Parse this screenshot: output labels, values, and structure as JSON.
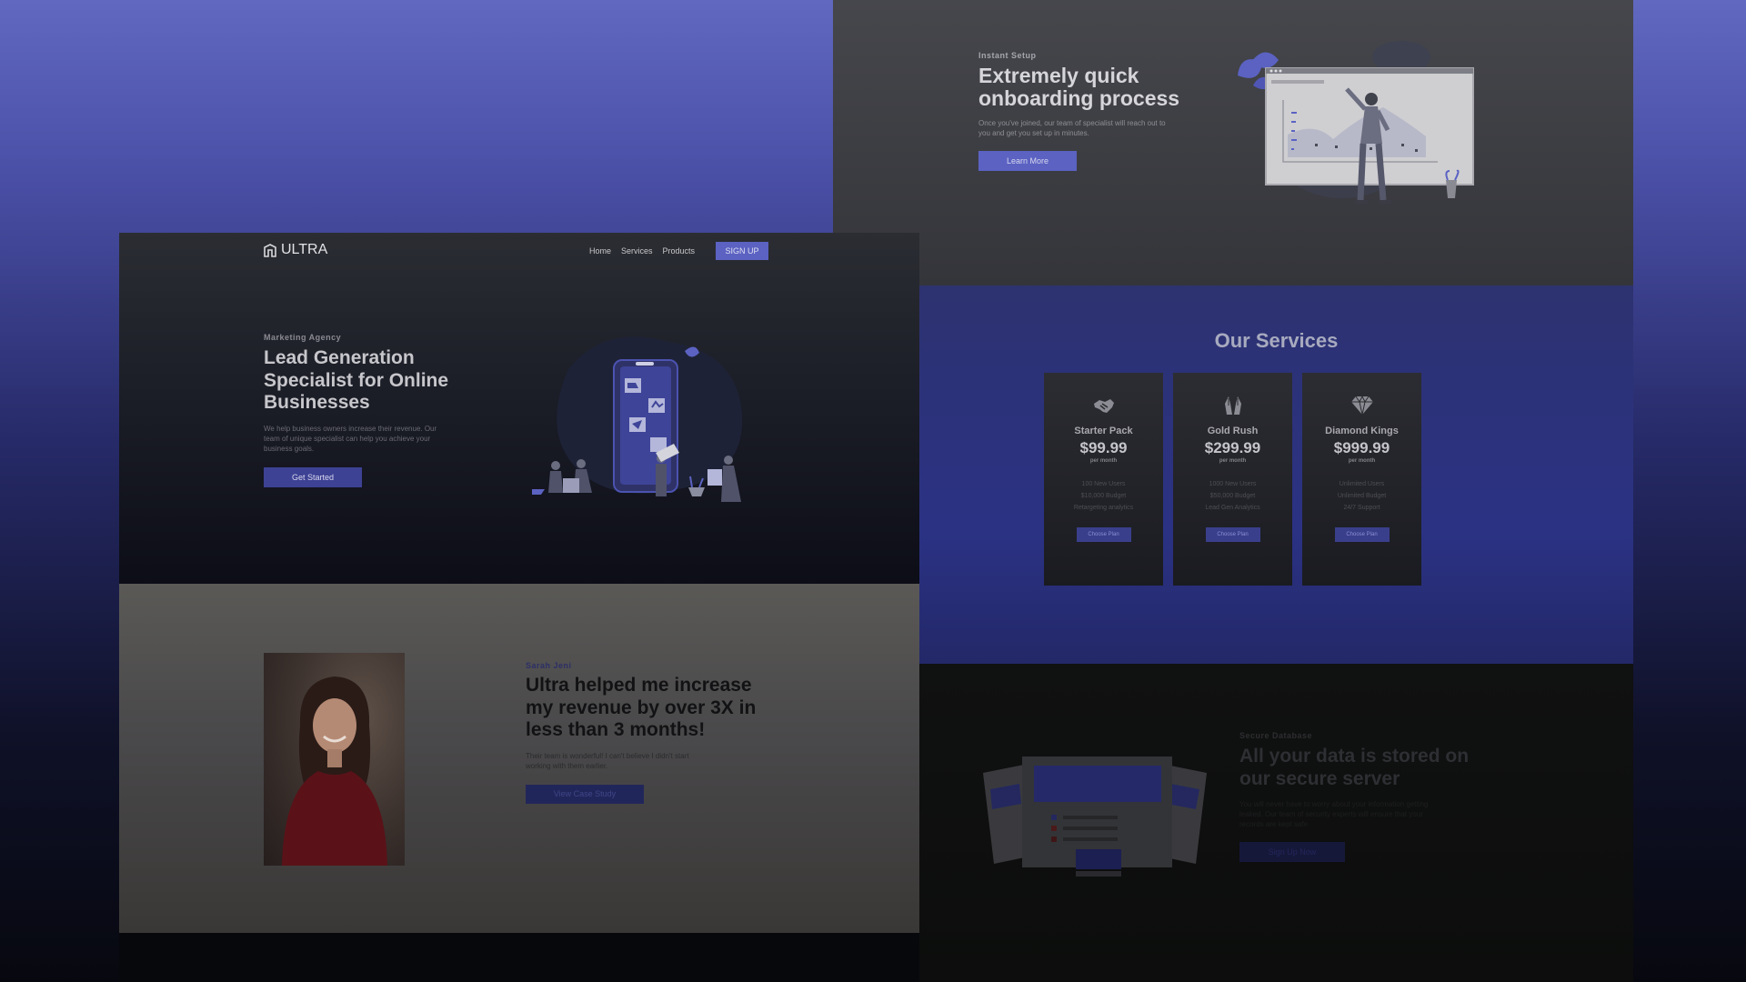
{
  "onboarding": {
    "eyebrow": "Instant Setup",
    "title": "Extremely quick onboarding process",
    "description": "Once you've joined, our team of specialist will reach out to you and get you set up in minutes.",
    "button": "Learn More"
  },
  "hero": {
    "brand": "ULTRA",
    "nav": [
      "Home",
      "Services",
      "Products"
    ],
    "signup": "SIGN UP",
    "eyebrow": "Marketing Agency",
    "title": "Lead Generation Specialist for Online Businesses",
    "description": "We help business owners increase their revenue. Our team of unique specialist can help you achieve your business goals.",
    "button": "Get Started"
  },
  "services": {
    "title": "Our Services",
    "cards": [
      {
        "icon": "handshake-icon",
        "name": "Starter Pack",
        "price": "$99.99",
        "period": "per month",
        "features": [
          "100 New Users",
          "$10,000 Budget",
          "Retargeting analytics"
        ],
        "button": "Choose Plan"
      },
      {
        "icon": "hands-icon",
        "name": "Gold Rush",
        "price": "$299.99",
        "period": "per month",
        "features": [
          "1000 New Users",
          "$50,000 Budget",
          "Lead Gen Analytics"
        ],
        "button": "Choose Plan"
      },
      {
        "icon": "diamond-icon",
        "name": "Diamond Kings",
        "price": "$999.99",
        "period": "per month",
        "features": [
          "Unlimited Users",
          "Unlimited Budget",
          "24/7 Support"
        ],
        "button": "Choose Plan"
      }
    ]
  },
  "testimonial": {
    "name": "Sarah Jeni",
    "quote": "Ultra helped me increase my revenue by over 3X in less than 3 months!",
    "description": "Their team is wonderful! I can't believe I didn't start working with them earlier.",
    "button": "View Case Study"
  },
  "secure": {
    "eyebrow": "Secure Database",
    "title": "All your data is stored on our secure server",
    "description": "You will never have to worry about your information getting leaked. Our team of security experts will ensure that your records are kept safe.",
    "button": "Sign Up Now"
  },
  "colors": {
    "accent": "#5b62c2",
    "accent_dark": "#3d4294",
    "background_top": "#6068c0",
    "background_bottom": "#07080f"
  }
}
